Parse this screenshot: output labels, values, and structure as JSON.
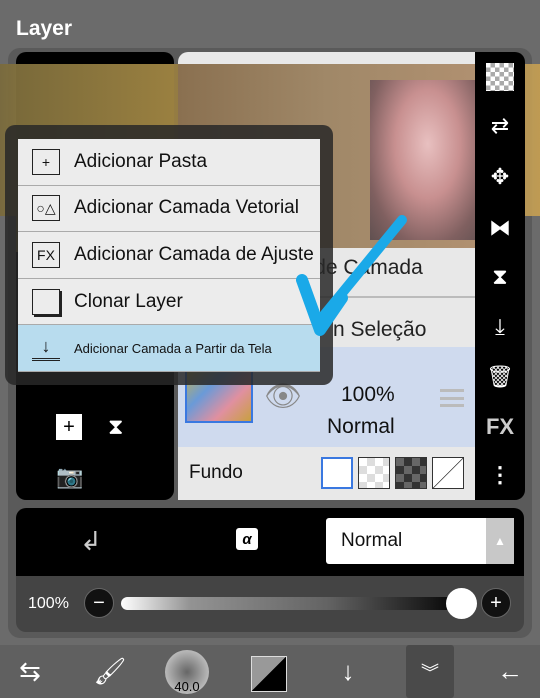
{
  "title": "Layer",
  "layer_list": {
    "fragment_1": "na de Camada",
    "fragment_2": "n Seleção",
    "active_layer": {
      "opacity": "100%",
      "blend": "Normal"
    },
    "background_label": "Fundo"
  },
  "menu": {
    "items": [
      {
        "label": "Adicionar Pasta",
        "icon": "folder-plus-icon"
      },
      {
        "label": "Adicionar Camada Vetorial",
        "icon": "vector-layer-icon"
      },
      {
        "label": "Adicionar Camada de Ajuste",
        "icon": "fx-layer-icon",
        "icon_text": "FX"
      },
      {
        "label": "Clonar Layer",
        "icon": "clone-icon"
      },
      {
        "label": "Adicionar Camada a Partir da Tela",
        "icon": "import-screen-icon",
        "highlighted": true
      }
    ]
  },
  "toolbar": {
    "fx_label": "FX"
  },
  "blend": {
    "mode": "Normal"
  },
  "opacity": {
    "label": "100%",
    "value": 100
  },
  "bottom": {
    "brush_size": "40.0"
  },
  "colors": {
    "highlight": "#b8dcee",
    "selected_layer": "#cfdaee",
    "annotation_arrow": "#1aa9e8"
  }
}
